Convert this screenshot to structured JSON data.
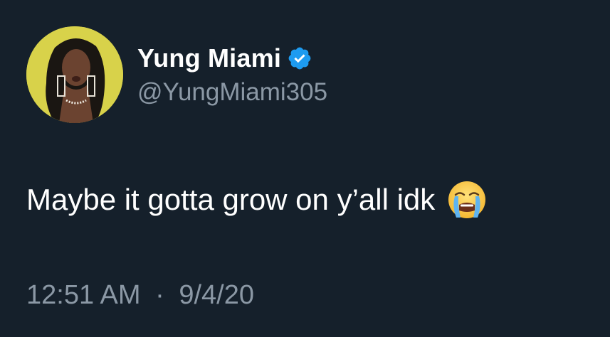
{
  "tweet": {
    "author": {
      "display_name": "Yung Miami",
      "handle": "@YungMiami305",
      "verified": true,
      "avatar_icon": "profile-photo"
    },
    "text": "Maybe it gotta grow on y’all idk",
    "emoji_icon": "loudly-crying-face-icon",
    "time": "12:51 AM",
    "separator": "·",
    "date": "9/4/20"
  },
  "colors": {
    "background": "#15202b",
    "primary_text": "#ffffff",
    "secondary_text": "#8b98a5",
    "verified_badge": "#1d9bf0",
    "avatar_background": "#d8d24a"
  }
}
